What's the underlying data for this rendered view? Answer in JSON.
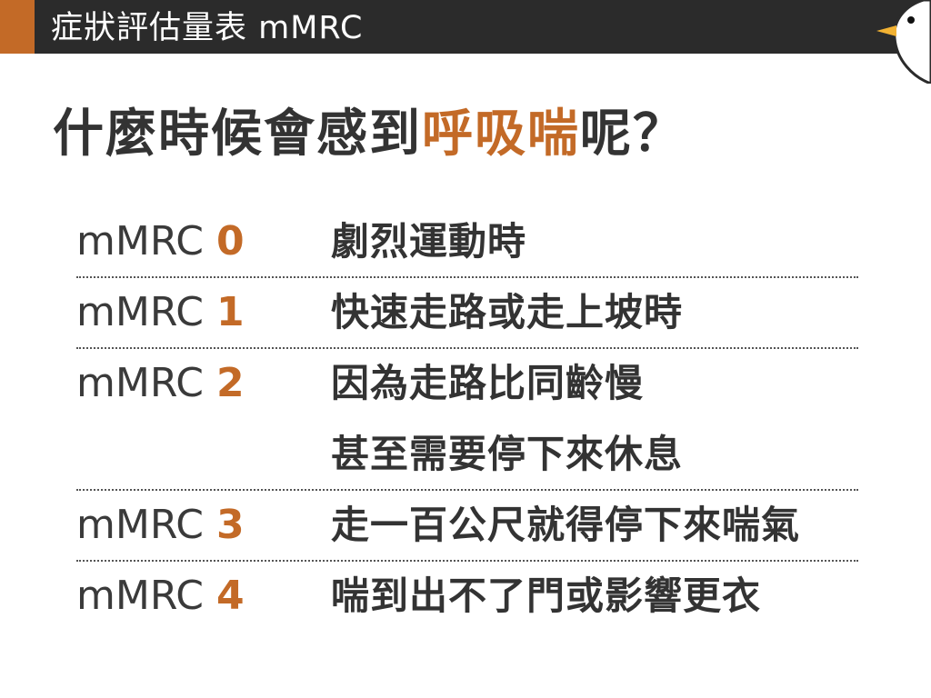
{
  "header": {
    "title": "症狀評估量表  mMRC",
    "accent_color": "#c36a27",
    "bar_color": "#2b2b2b"
  },
  "question": {
    "prefix": "什麼時候會感到",
    "highlight": "呼吸喘",
    "suffix": "呢？"
  },
  "scale": {
    "prefix": "mMRC",
    "rows": [
      {
        "level": "0",
        "lines": [
          "劇烈運動時"
        ]
      },
      {
        "level": "1",
        "lines": [
          "快速走路或走上坡時"
        ]
      },
      {
        "level": "2",
        "lines": [
          "因為走路比同齡慢",
          "甚至需要停下來休息"
        ]
      },
      {
        "level": "3",
        "lines": [
          "走一百公尺就得停下來喘氣"
        ]
      },
      {
        "level": "4",
        "lines": [
          "喘到出不了門或影響更衣"
        ]
      }
    ]
  },
  "mascot": {
    "icon": "bird-mascot-icon"
  }
}
